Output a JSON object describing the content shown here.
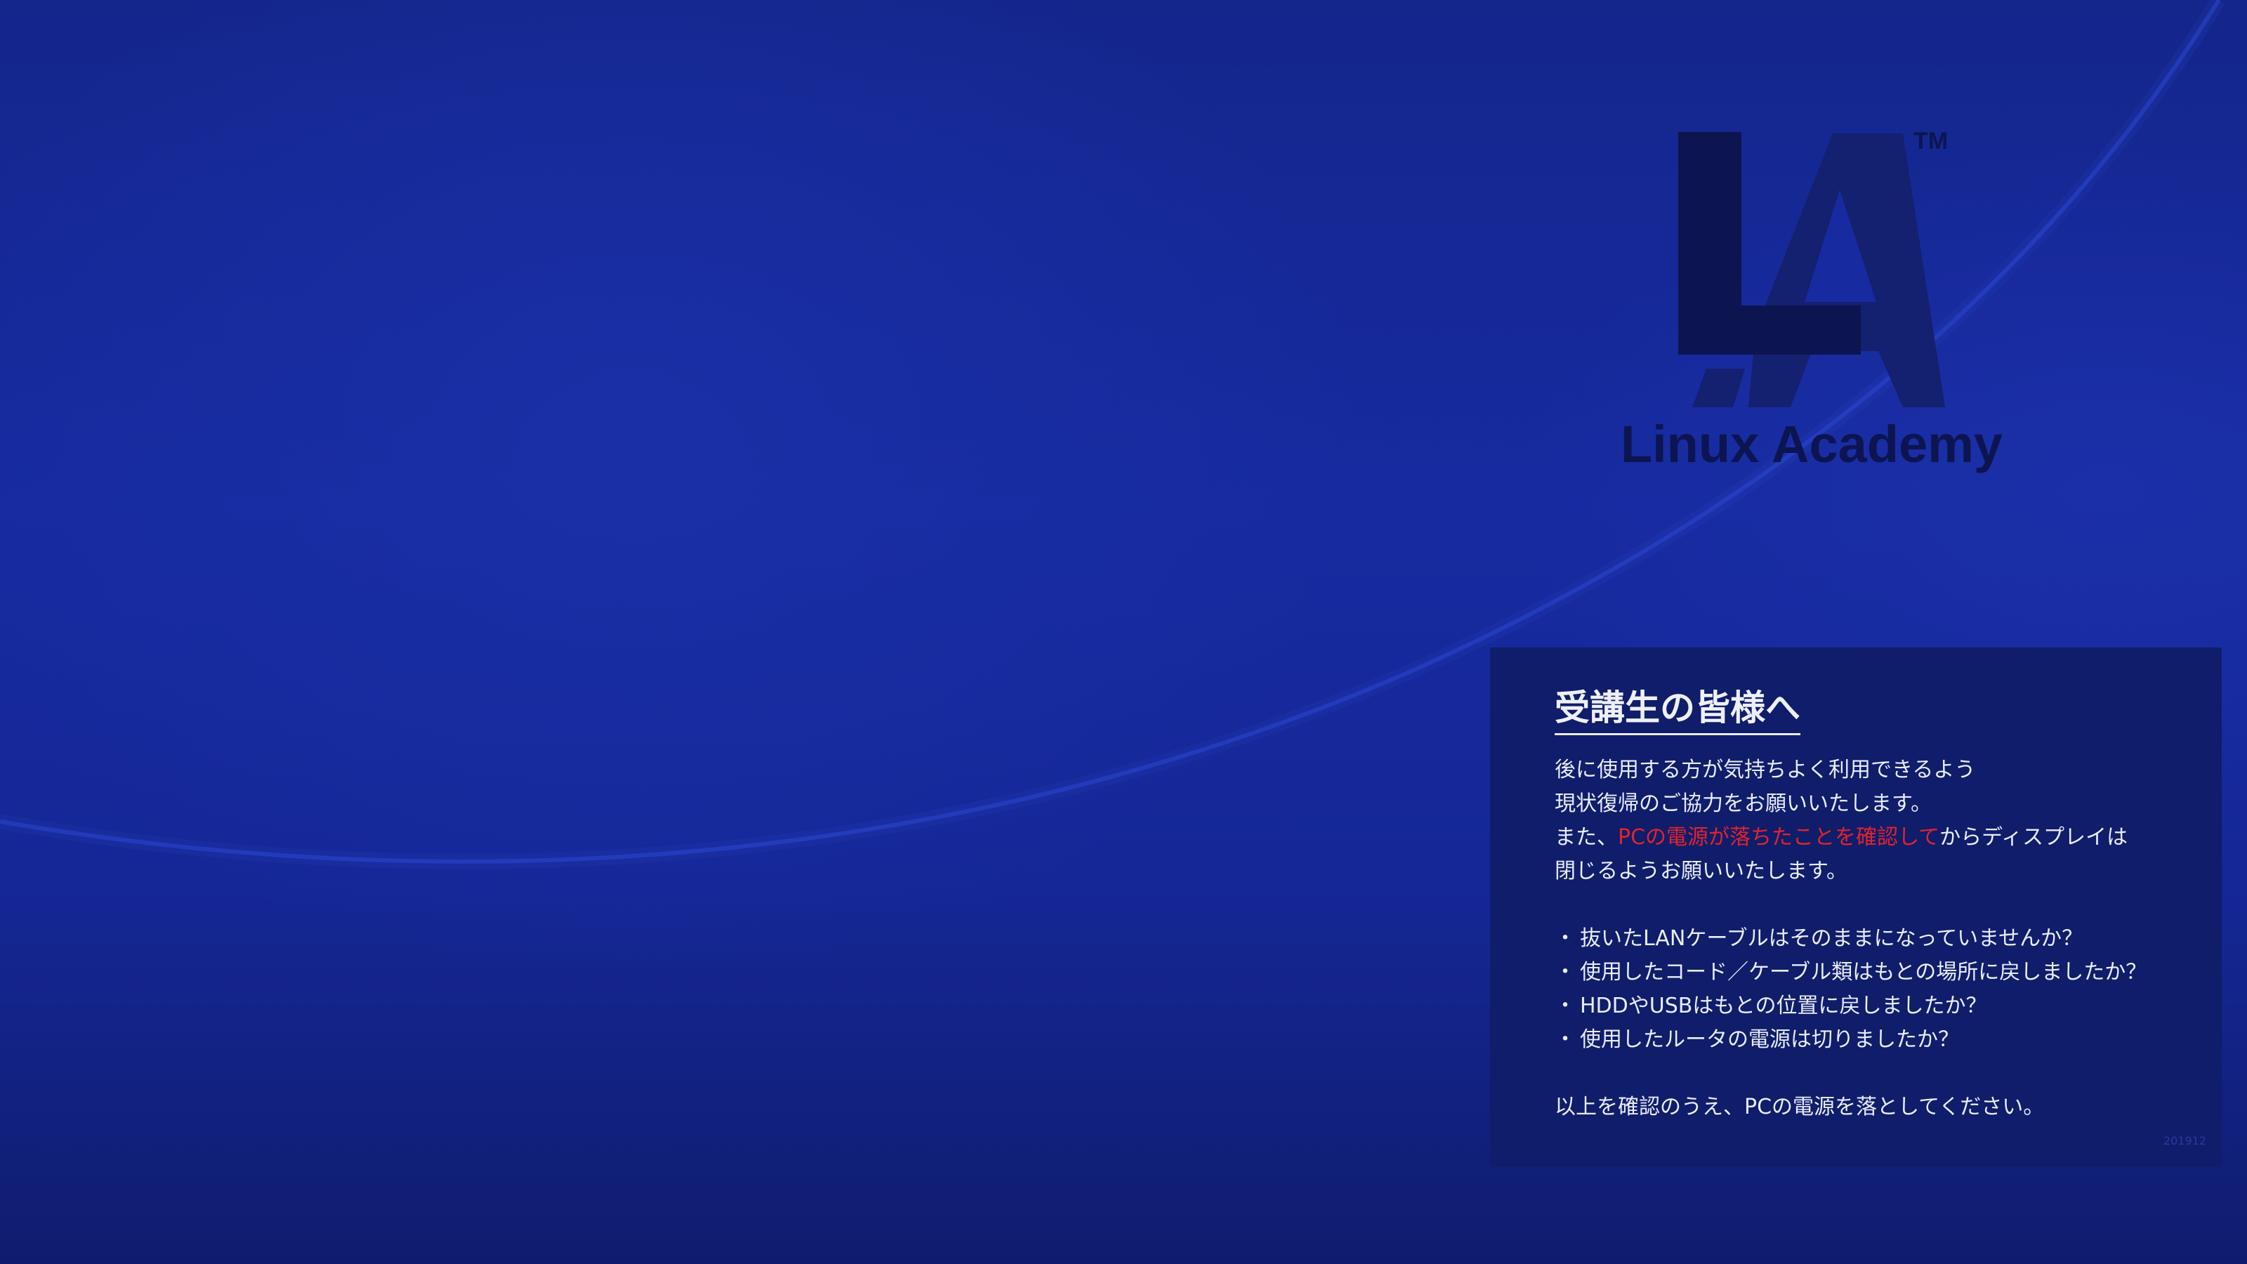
{
  "logo": {
    "name": "Linux Academy",
    "tm": "TM",
    "color": "#0c1550"
  },
  "notice": {
    "title": "受講生の皆様へ",
    "intro_line1": "後に使用する方が気持ちよく利用できるよう",
    "intro_line2": "現状復帰のご協力をお願いいたします。",
    "intro_line3_pre": "また、",
    "intro_line3_red": "PCの電源が落ちたことを確認して",
    "intro_line3_post": "からディスプレイは",
    "intro_line4": "閉じるようお願いいたします。",
    "bullets": [
      "抜いたLANケーブルはそのままになっていませんか？",
      "使用したコード／ケーブル類はもとの場所に戻しましたか？",
      "HDDやUSBはもとの位置に戻しましたか？",
      "使用したルータの電源は切りましたか？"
    ],
    "bullet_mark": "・",
    "closing": "以上を確認のうえ、PCの電源を落としてください。",
    "stamp": "201912",
    "highlight_color": "#e2232d",
    "panel_color": "#0f1d6b"
  },
  "background": {
    "base_color": "#172aa0",
    "arc_color": "#2540c8"
  }
}
